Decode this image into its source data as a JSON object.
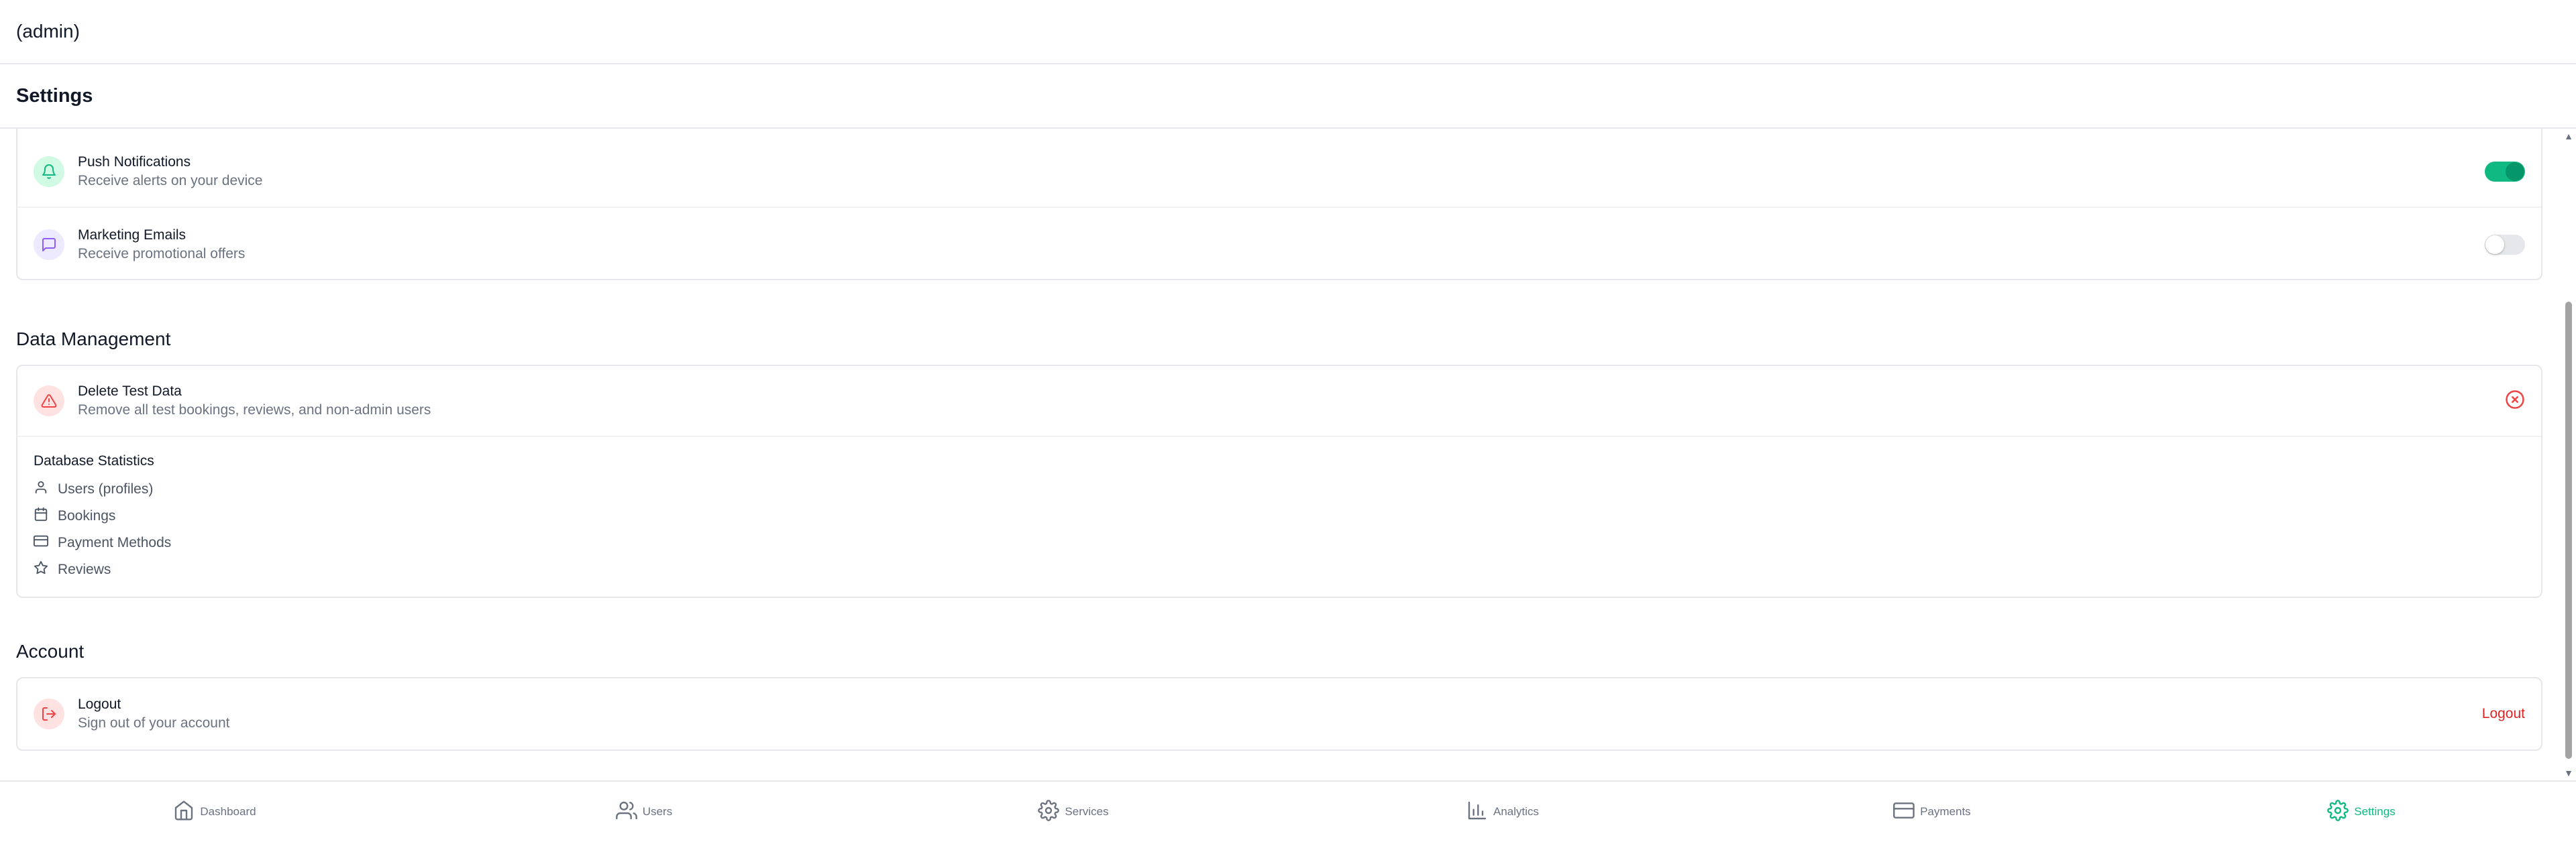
{
  "header": {
    "user_label": "(admin)"
  },
  "page": {
    "title": "Settings"
  },
  "notifications": {
    "items": [
      {
        "title": "Push Notifications",
        "subtitle": "Receive alerts on your device",
        "enabled": true,
        "icon": "bell-icon",
        "color": "#10b981"
      },
      {
        "title": "Marketing Emails",
        "subtitle": "Receive promotional offers",
        "enabled": false,
        "icon": "message-square-icon",
        "color": "#8b5cf6"
      }
    ]
  },
  "data_management": {
    "heading": "Data Management",
    "delete": {
      "title": "Delete Test Data",
      "subtitle": "Remove all test bookings, reviews, and non-admin users",
      "icon": "alert-triangle-icon",
      "action_icon": "x-circle-icon",
      "color": "#ef4444"
    },
    "stats": {
      "title": "Database Statistics",
      "items": [
        {
          "label": "Users (profiles)",
          "icon": "user-icon"
        },
        {
          "label": "Bookings",
          "icon": "calendar-icon"
        },
        {
          "label": "Payment Methods",
          "icon": "credit-card-icon"
        },
        {
          "label": "Reviews",
          "icon": "star-icon"
        }
      ]
    }
  },
  "account": {
    "heading": "Account",
    "logout": {
      "title": "Logout",
      "subtitle": "Sign out of your account",
      "action_label": "Logout",
      "icon": "log-out-icon",
      "color": "#dc2626"
    }
  },
  "bottom_nav": {
    "items": [
      {
        "label": "Dashboard",
        "icon": "home-icon",
        "active": false
      },
      {
        "label": "Users",
        "icon": "users-icon",
        "active": false
      },
      {
        "label": "Services",
        "icon": "gear-icon",
        "active": false
      },
      {
        "label": "Analytics",
        "icon": "bar-chart-icon",
        "active": false
      },
      {
        "label": "Payments",
        "icon": "credit-card-icon",
        "active": false
      },
      {
        "label": "Settings",
        "icon": "settings-icon",
        "active": true
      }
    ],
    "active_color": "#10b981"
  }
}
